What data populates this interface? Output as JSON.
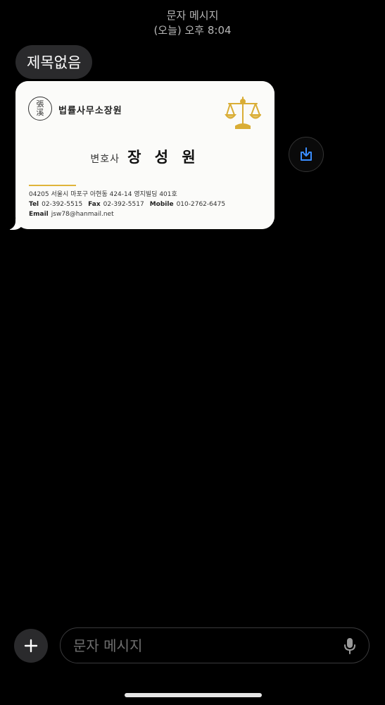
{
  "header": {
    "title": "문자 메시지",
    "timestamp": "(오늘) 오후 8:04"
  },
  "message": {
    "subject": "제목없음",
    "card": {
      "seal_chars": [
        "張",
        "溪"
      ],
      "firm_name": "법률사무소장원",
      "title_label": "변호사",
      "name": "장 성 원",
      "address": "04205 서울시 마포구 아현동 424-14 영지빌딩 401호",
      "tel_label": "Tel",
      "tel": "02-392-5515",
      "fax_label": "Fax",
      "fax": "02-392-5517",
      "mobile_label": "Mobile",
      "mobile": "010-2762-6475",
      "email_label": "Email",
      "email": "jsw78@hanmail.net",
      "accent_color": "#e0b43a"
    },
    "save_icon": "save-to-device-icon"
  },
  "composer": {
    "placeholder": "문자 메시지",
    "add_icon": "plus-icon",
    "mic_icon": "microphone-icon"
  },
  "colors": {
    "background": "#000000",
    "bubble": "#ffffff",
    "pill": "#2a2a2c",
    "icon_accent": "#3a8dff"
  }
}
